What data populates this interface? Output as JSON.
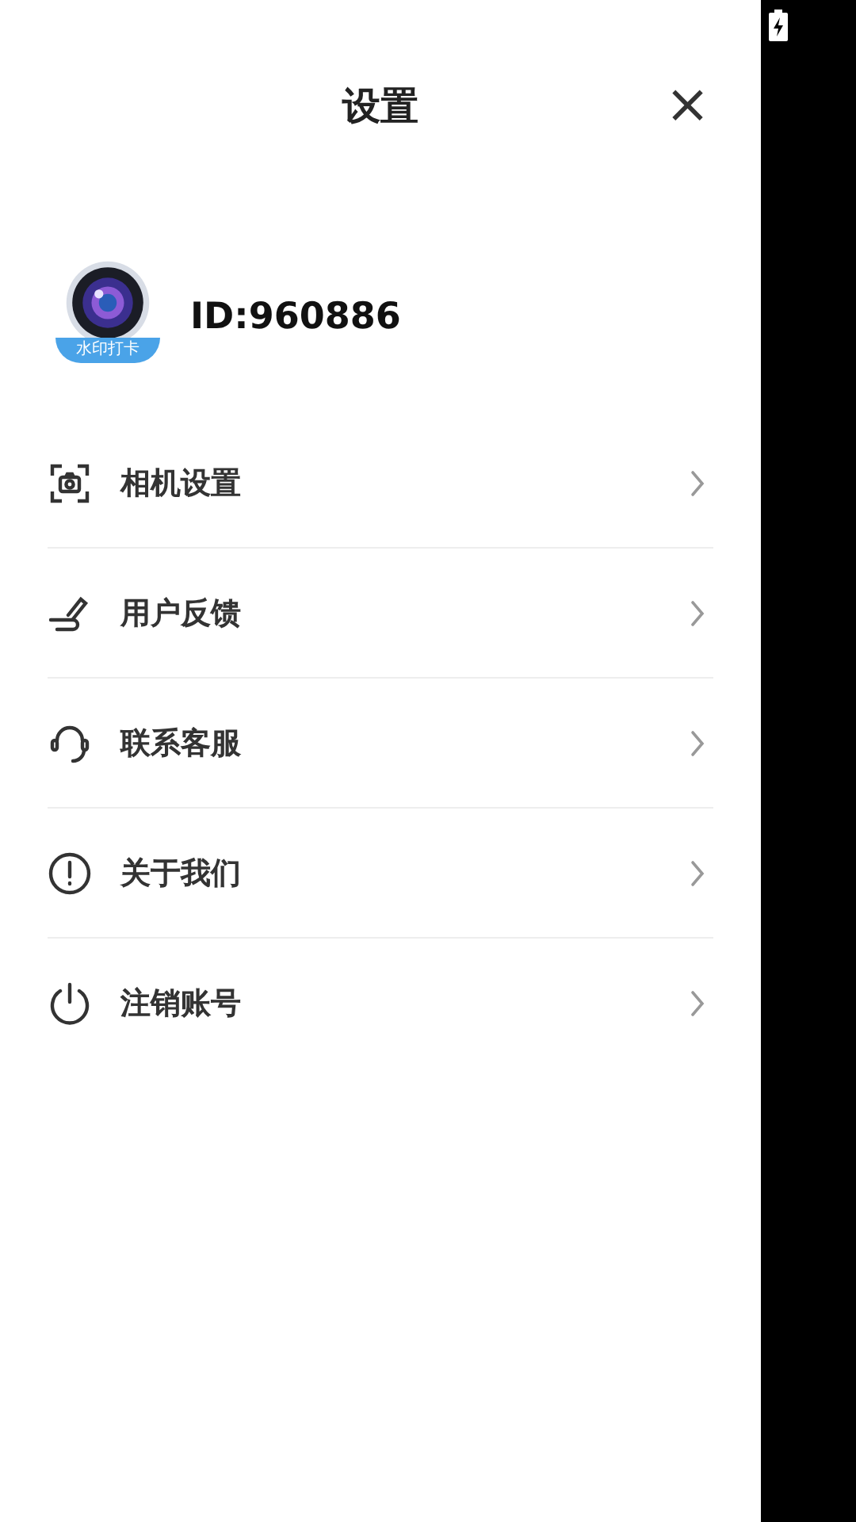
{
  "header": {
    "title": "设置",
    "close": "×"
  },
  "profile": {
    "avatar_label": "水印打卡",
    "id": "ID:960886"
  },
  "menu": [
    {
      "label": "相机设置"
    },
    {
      "label": "用户反馈"
    },
    {
      "label": "联系客服"
    },
    {
      "label": "关于我们"
    },
    {
      "label": "注销账号"
    }
  ]
}
